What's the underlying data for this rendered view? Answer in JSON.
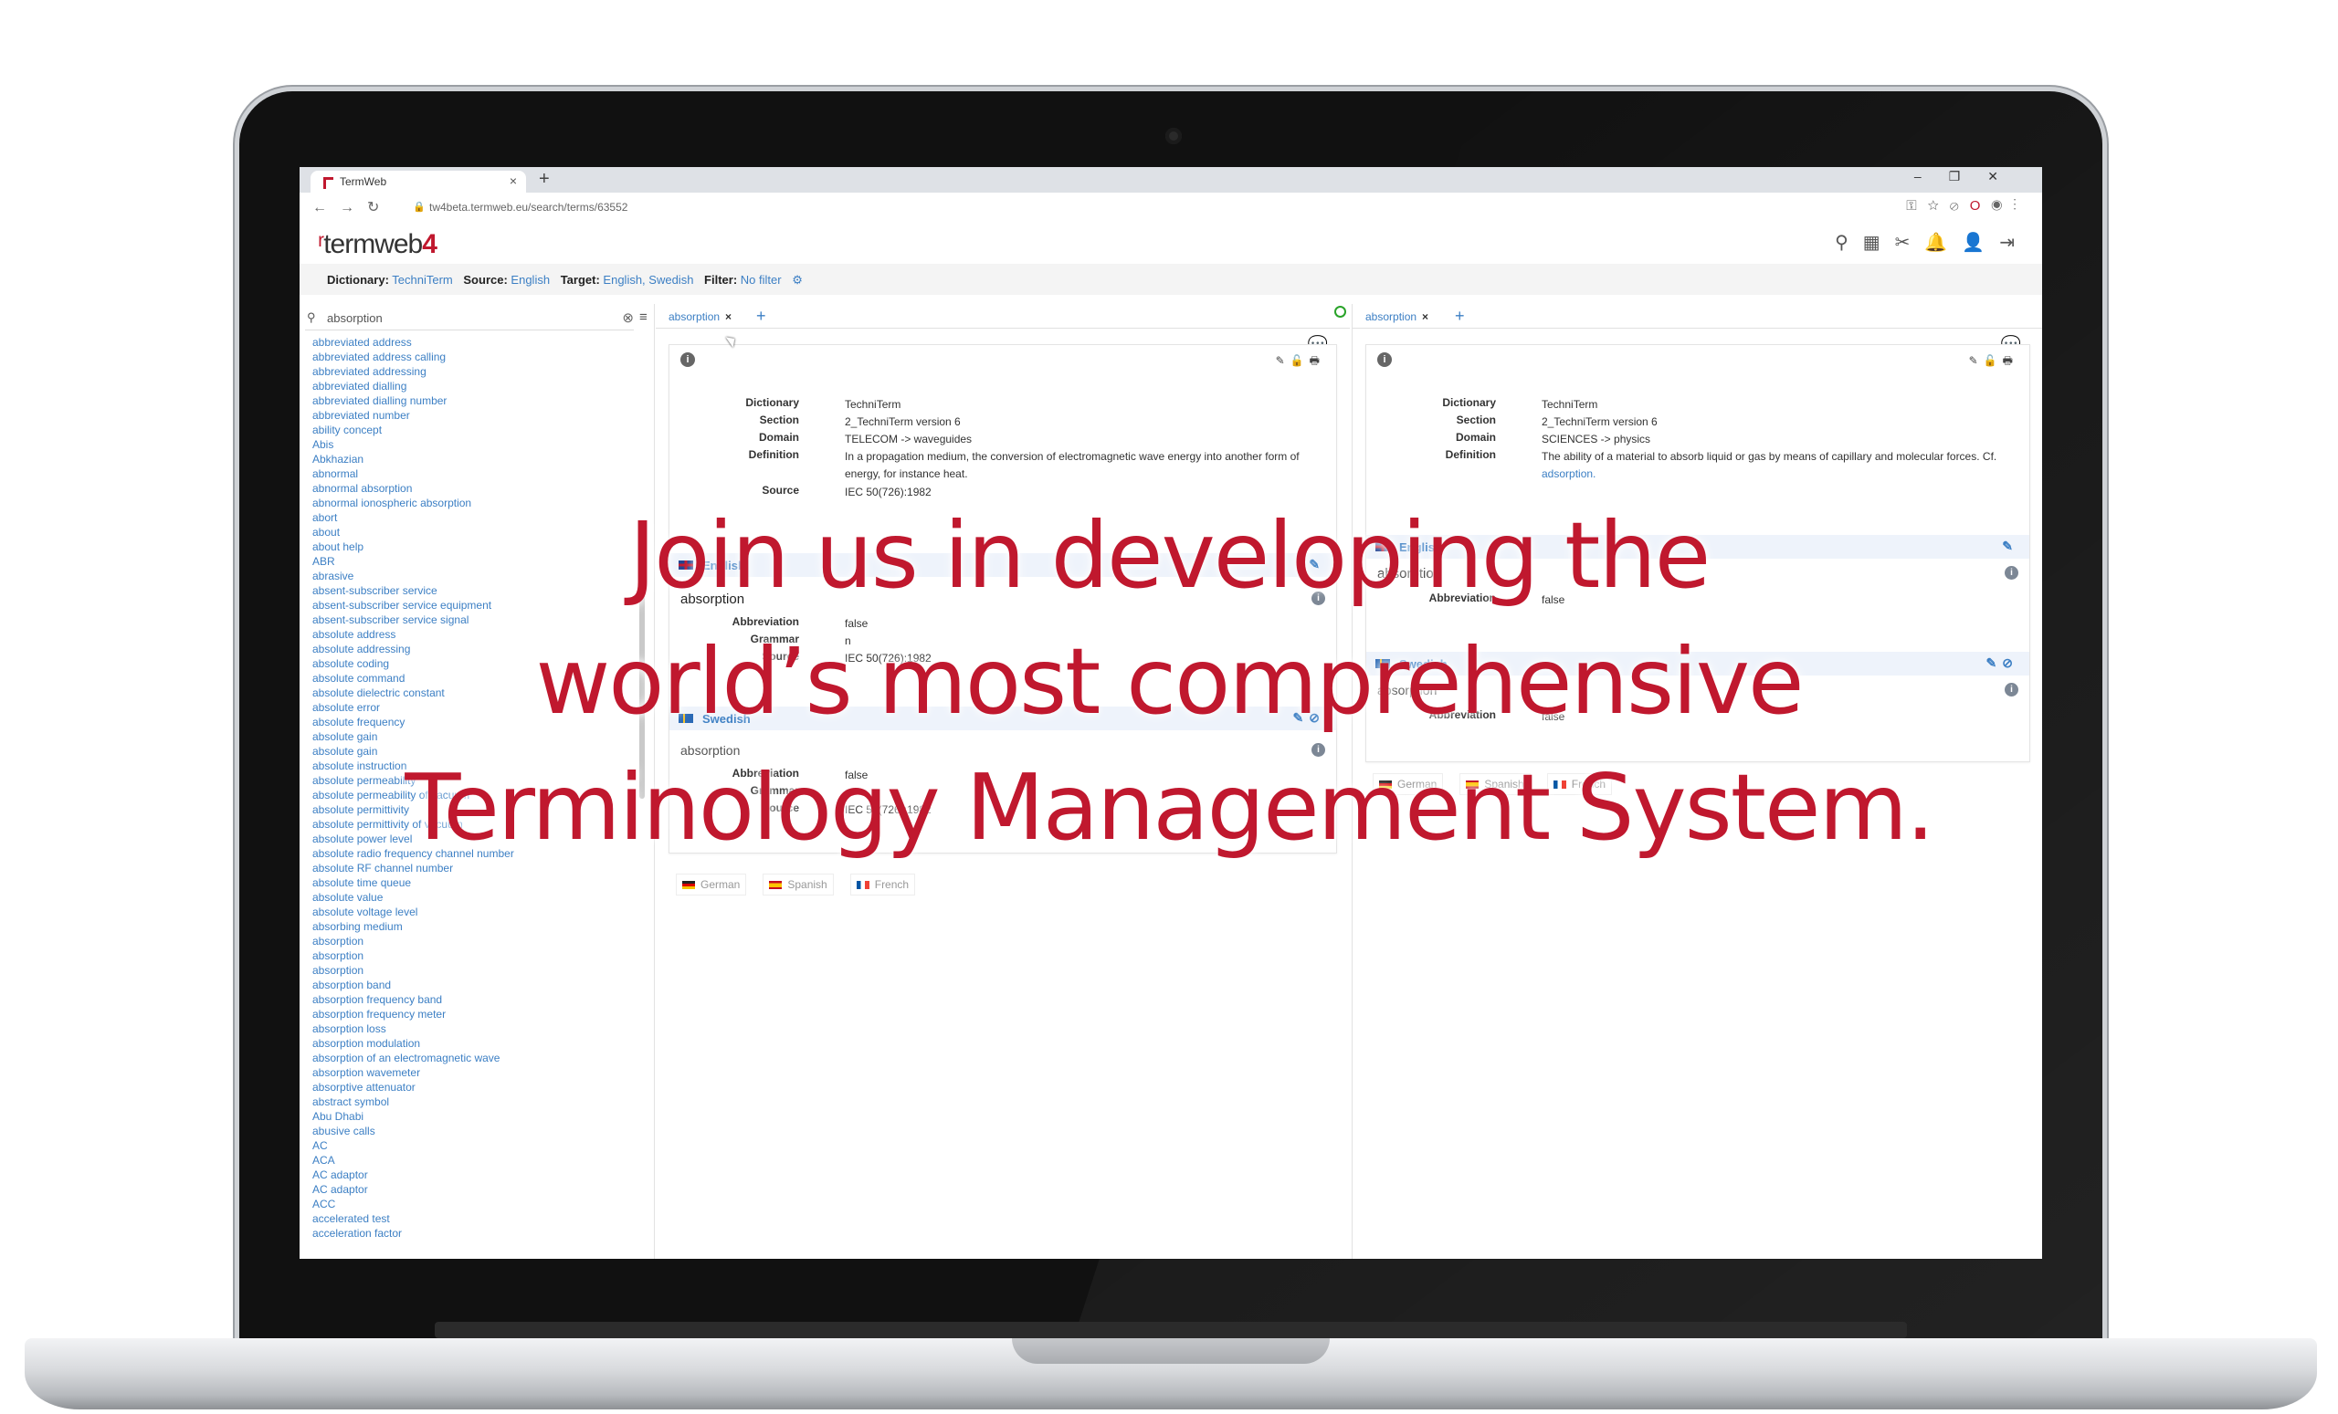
{
  "browser": {
    "tab_title": "TermWeb",
    "url": "tw4beta.termweb.eu/search/terms/63552"
  },
  "app": {
    "logo_text": "termweb",
    "logo_version": "4"
  },
  "filter": {
    "dictionary_label": "Dictionary:",
    "dictionary_value": "TechniTerm",
    "source_label": "Source:",
    "source_value": "English",
    "target_label": "Target:",
    "target_value": "English, Swedish",
    "filter_label": "Filter:",
    "filter_value": "No filter"
  },
  "search": {
    "query": "absorption"
  },
  "term_list": [
    "abbreviated address",
    "abbreviated address calling",
    "abbreviated addressing",
    "abbreviated dialling",
    "abbreviated dialling number",
    "abbreviated number",
    "ability concept",
    "Abis",
    "Abkhazian",
    "abnormal",
    "abnormal absorption",
    "abnormal ionospheric absorption",
    "abort",
    "about",
    "about help",
    "ABR",
    "abrasive",
    "absent-subscriber service",
    "absent-subscriber service equipment",
    "absent-subscriber service signal",
    "absolute address",
    "absolute addressing",
    "absolute coding",
    "absolute command",
    "absolute dielectric constant",
    "absolute error",
    "absolute frequency",
    "absolute gain",
    "absolute gain",
    "absolute instruction",
    "absolute permeability",
    "absolute permeability of vacuum",
    "absolute permittivity",
    "absolute permittivity of vacuum",
    "absolute power level",
    "absolute radio frequency channel number",
    "absolute RF channel number",
    "absolute time queue",
    "absolute value",
    "absolute voltage level",
    "absorbing medium",
    "absorption",
    "absorption",
    "absorption",
    "absorption band",
    "absorption frequency band",
    "absorption frequency meter",
    "absorption loss",
    "absorption modulation",
    "absorption of an electromagnetic wave",
    "absorption wavemeter",
    "absorptive attenuator",
    "abstract symbol",
    "Abu Dhabi",
    "abusive calls",
    "AC",
    "ACA",
    "AC adaptor",
    "AC adaptor",
    "ACC",
    "accelerated test",
    "acceleration factor"
  ],
  "pane1": {
    "tab_label": "absorption",
    "details": {
      "dictionary_k": "Dictionary",
      "dictionary_v": "TechniTerm",
      "section_k": "Section",
      "section_v": "2_TechniTerm version 6",
      "domain_k": "Domain",
      "domain_v": "TELECOM -> waveguides",
      "definition_k": "Definition",
      "definition_v": "In a propagation medium, the conversion of electromagnetic wave energy into another form of energy, for instance heat.",
      "source_k": "Source",
      "source_v": "IEC 50(726):1982"
    },
    "english": {
      "lang": "English",
      "term": "absorption",
      "abbr_k": "Abbreviation",
      "abbr_v": "false",
      "gram_k": "Grammar",
      "gram_v": "n",
      "source_k": "Source",
      "source_v": "IEC 50(726):1982"
    },
    "swedish": {
      "lang": "Swedish",
      "term": "absorption",
      "abbr_k": "Abbreviation",
      "abbr_v": "false",
      "gram_k": "Grammar",
      "gram_v": "n",
      "source_k": "Source",
      "source_v": "IEC 50(726):1982"
    },
    "more_langs": [
      "German",
      "Spanish",
      "French"
    ]
  },
  "pane2": {
    "tab_label": "absorption",
    "details": {
      "dictionary_k": "Dictionary",
      "dictionary_v": "TechniTerm",
      "section_k": "Section",
      "section_v": "2_TechniTerm version 6",
      "domain_k": "Domain",
      "domain_v": "SCIENCES -> physics",
      "definition_k": "Definition",
      "definition_v": "The ability of a material to absorb liquid or gas by means of capillary and molecular forces. Cf.",
      "definition_link": "adsorption."
    },
    "english": {
      "lang": "English",
      "term": "absorption",
      "abbr_k": "Abbreviation",
      "abbr_v": "false"
    },
    "swedish": {
      "lang": "Swedish",
      "term": "absorption",
      "abbr_k": "Abbreviation",
      "abbr_v": "false"
    },
    "more_langs": [
      "German",
      "Spanish",
      "French"
    ]
  },
  "overlay": {
    "line1": "Join us in developing the",
    "line2": "world’s most comprehensive",
    "line3": "Terminology Management System."
  },
  "colors": {
    "brand_red": "#c0182e",
    "link_blue": "#3c7fc4"
  }
}
